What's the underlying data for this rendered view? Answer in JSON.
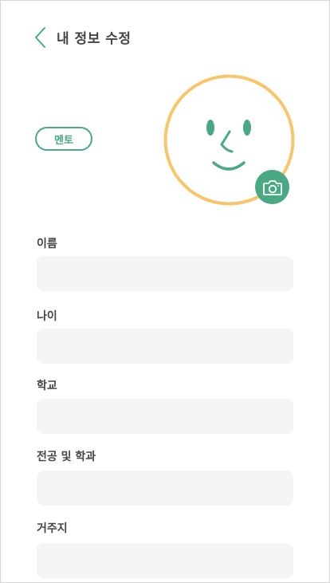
{
  "header": {
    "title": "내 정보 수정",
    "back_icon": "chevron-left-icon"
  },
  "profile": {
    "role_badge": "멘토",
    "avatar_icon": "smiley-face-avatar",
    "camera_icon": "camera-icon"
  },
  "form": {
    "fields": [
      {
        "label": "이름",
        "value": "",
        "placeholder": ""
      },
      {
        "label": "나이",
        "value": "",
        "placeholder": ""
      },
      {
        "label": "학교",
        "value": "",
        "placeholder": ""
      },
      {
        "label": "전공 및 학과",
        "value": "",
        "placeholder": ""
      },
      {
        "label": "거주지",
        "value": "",
        "placeholder": ""
      }
    ]
  },
  "colors": {
    "accent_green": "#4aa985",
    "avatar_ring": "#f9c56a",
    "input_bg": "#f5f5f5",
    "text_dark": "#444444"
  }
}
